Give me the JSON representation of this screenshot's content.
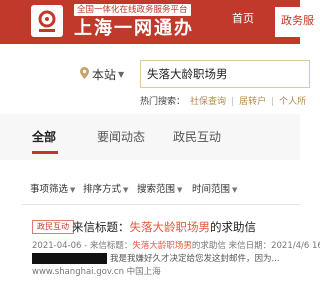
{
  "header": {
    "brand_sub": "全国一体化在线政务服务平台",
    "brand_main": "上海一网通办",
    "nav": [
      "首页",
      "政务服务"
    ]
  },
  "search": {
    "site_label": "本站",
    "query": "失落大龄职场男",
    "hot_label": "热门搜索：",
    "hot_items": [
      "社保查询",
      "居转户",
      "个人所"
    ]
  },
  "tabs": [
    {
      "label": "全部",
      "active": true
    },
    {
      "label": "要闻动态",
      "active": false
    },
    {
      "label": "政民互动",
      "active": false
    }
  ],
  "filters": [
    "事项筛选",
    "排序方式",
    "搜索范围",
    "时间范围"
  ],
  "result": {
    "badge": "政民互动",
    "title_prefix": "来信标题：",
    "title_highlight": "失落大龄职场男",
    "title_suffix": "的求助信",
    "meta_date": "2021-04-06",
    "meta_prefix": " - 来信标题：",
    "meta_highlight": "失落大龄职场男",
    "meta_suffix": "的求助信 来信日期：",
    "meta_date2": "2021/4/6 16:",
    "snippet": "我是我嫌好久才决定给您发这封邮件，因为...",
    "url": "www.shanghai.gov.cn 中国上海"
  },
  "colors": {
    "header_red": "#c0392b",
    "highlight": "#e25a3a",
    "hot_link": "#b08a4e"
  }
}
